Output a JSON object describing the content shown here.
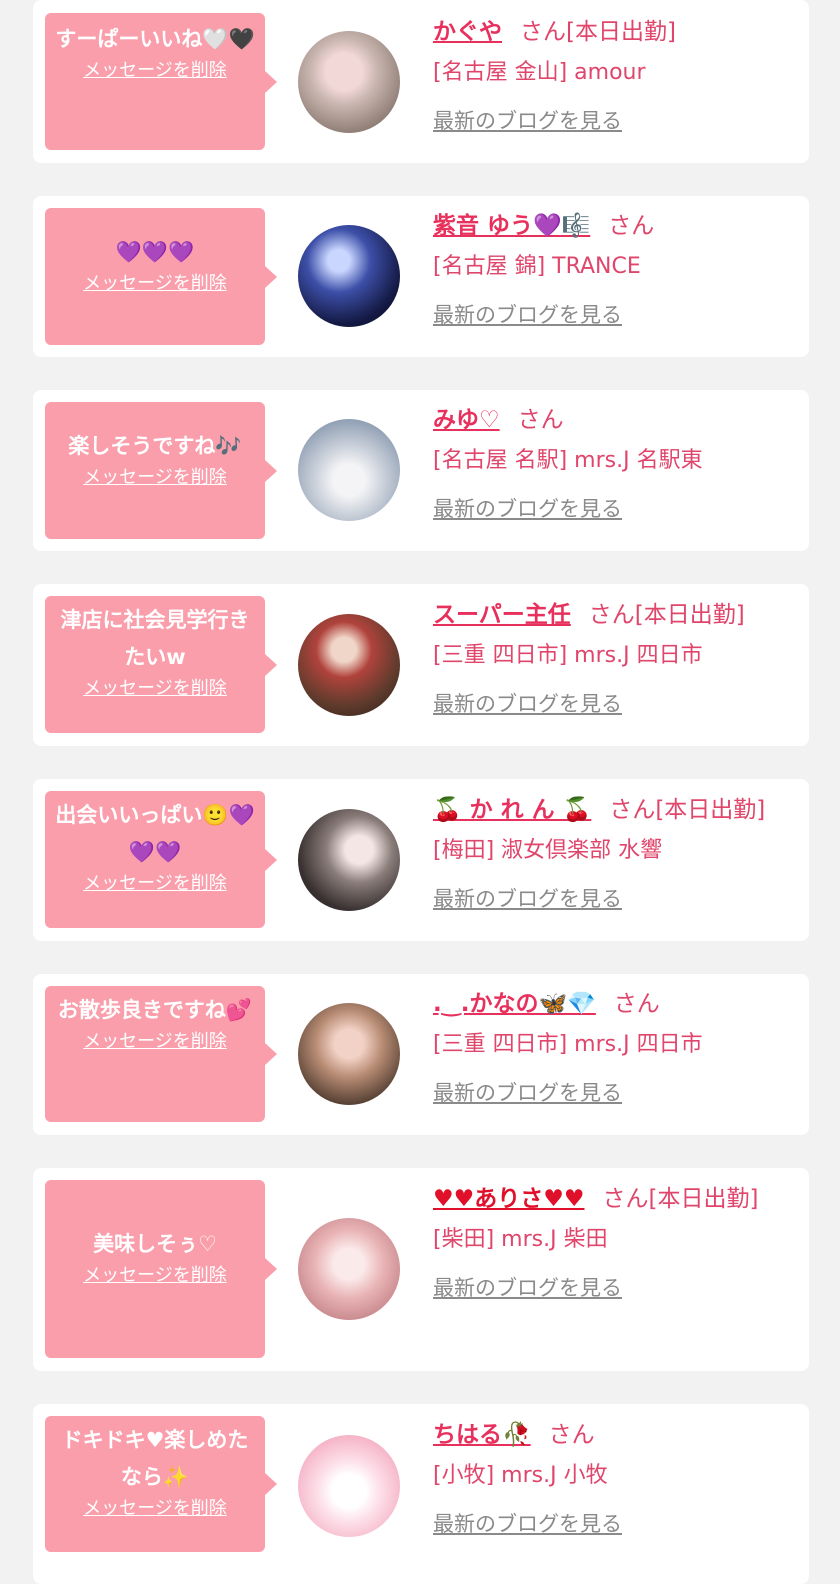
{
  "delete_label": "メッセージを削除",
  "blog_label": "最新のブログを見る",
  "cards": [
    {
      "message": "すーぱーいいね🤍🖤",
      "name": "かぐや",
      "san": "さん[本日出勤]",
      "shop": "[名古屋 金山] amour"
    },
    {
      "message": "💜💜💜",
      "name": "紫音 ゆう💜🎼",
      "san": "さん",
      "shop": "[名古屋 錦] TRANCE"
    },
    {
      "message": "楽しそうですね🎶",
      "name": "みゆ♡",
      "san": "さん",
      "shop": "[名古屋 名駅] mrs.J 名駅東"
    },
    {
      "message": "津店に社会見学行きたいw",
      "name": "スーパー主任",
      "san": "さん[本日出勤]",
      "shop": "[三重 四日市] mrs.J 四日市"
    },
    {
      "message": "出会いいっぱい🙂💜💜💜",
      "name": "🍒 か れ ん 🍒",
      "san": "さん[本日出勤]",
      "shop": "[梅田] 淑女倶楽部 水響"
    },
    {
      "message": "お散歩良きですね💕",
      "name": ".‿.かなの🦋💎",
      "san": "さん",
      "shop": "[三重 四日市] mrs.J 四日市"
    },
    {
      "message": "美味しそぅ♡",
      "name": "♥♥ありさ♥♥",
      "san": "さん[本日出勤]",
      "shop": "[柴田] mrs.J 柴田"
    },
    {
      "message": "ドキドキ♥楽しめたなら✨",
      "name": "ちはる🥀",
      "san": "さん",
      "shop": "[小牧] mrs.J 小牧"
    }
  ],
  "colors": {
    "bubble": "#fa9eab",
    "name": "#e8305c",
    "text": "#e0456b",
    "link_gray": "#8a8a8a",
    "background": "#f2f2f2"
  },
  "icons": [
    "white-heart-icon",
    "black-heart-icon",
    "purple-heart-icon",
    "music-notes-icon",
    "smile-icon",
    "cherries-icon",
    "butterfly-icon",
    "gem-icon",
    "red-heart-icon",
    "sparkles-icon",
    "rose-icon"
  ]
}
